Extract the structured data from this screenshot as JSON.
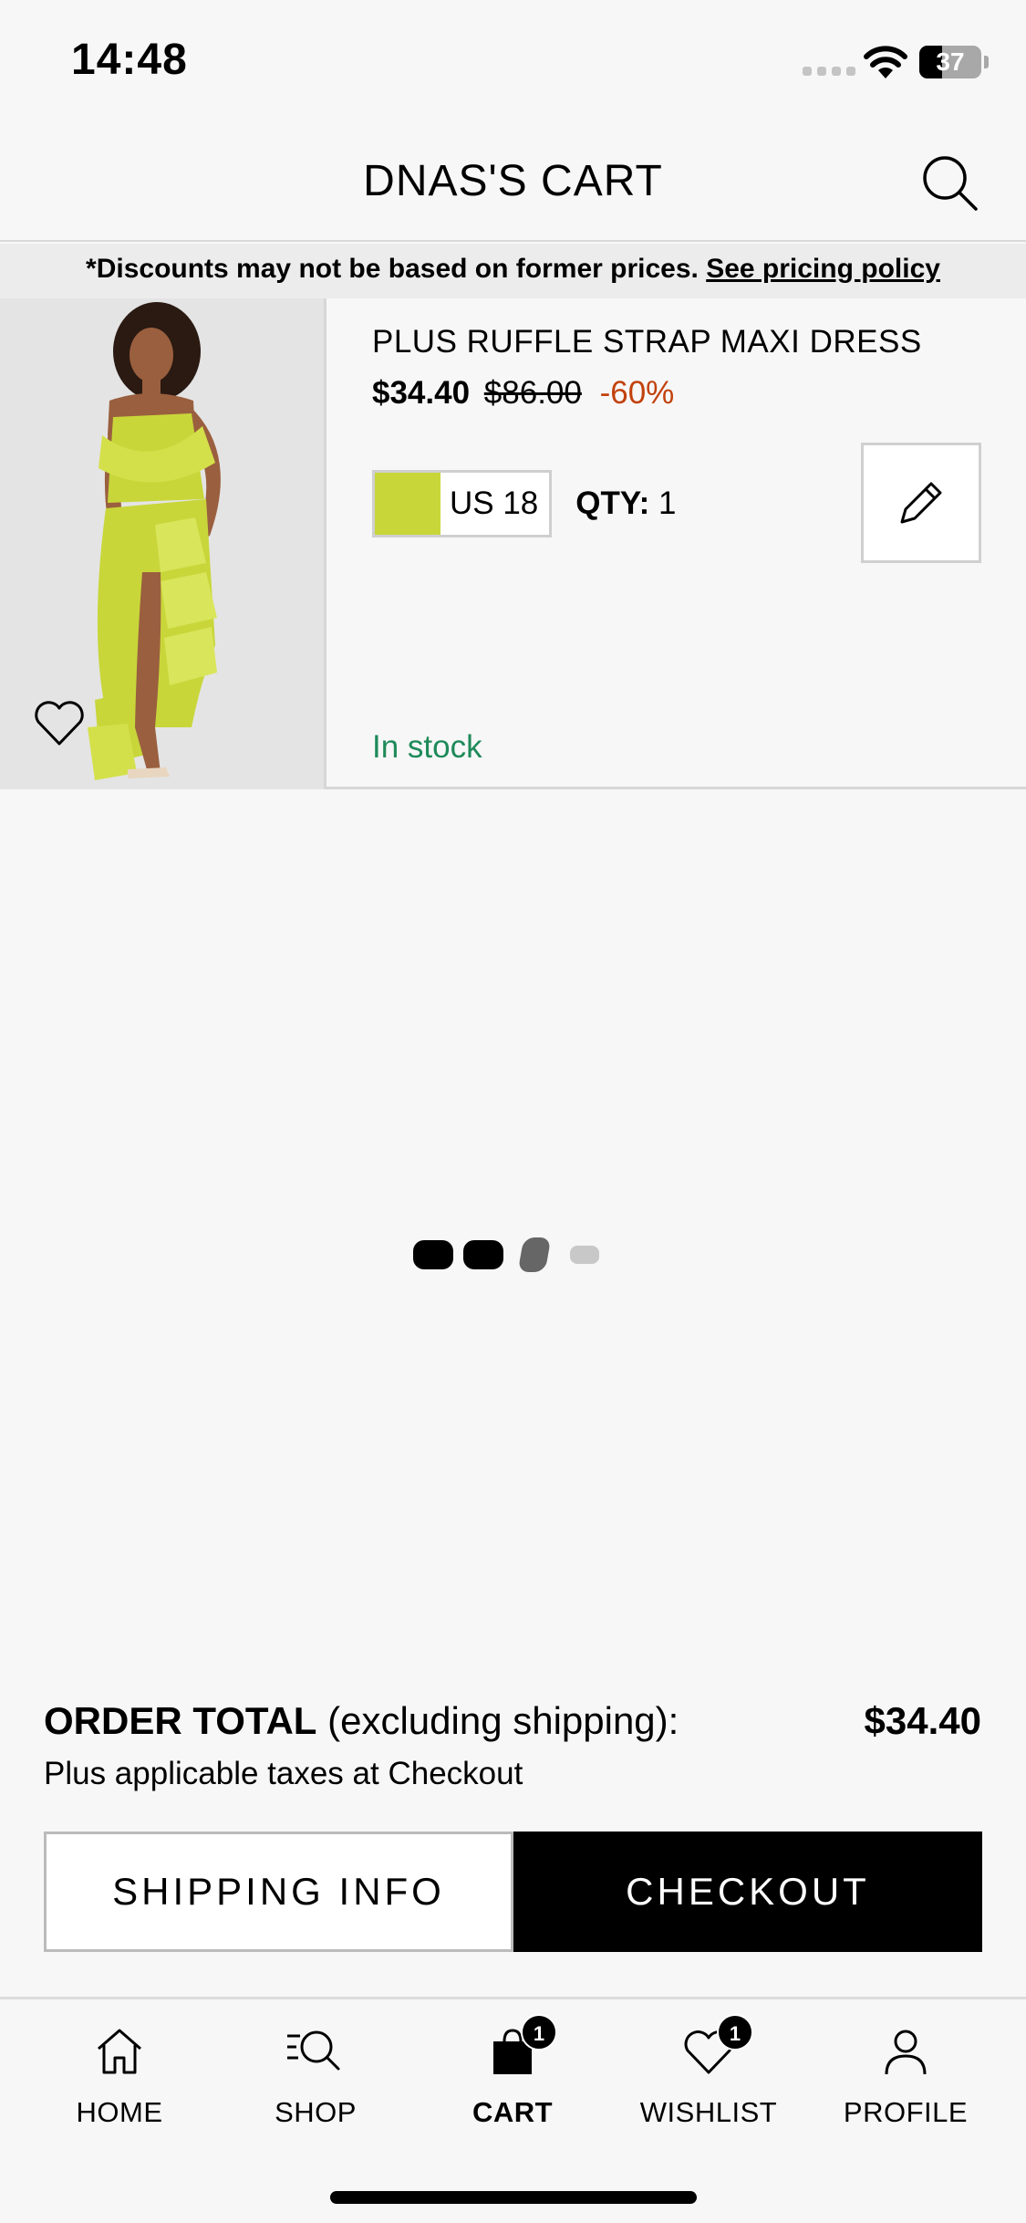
{
  "status_bar": {
    "time": "14:48",
    "battery": "37",
    "battery_level": 0.37
  },
  "header": {
    "title": "DNAS'S CART"
  },
  "banner": {
    "text": "*Discounts may not be based on former prices. ",
    "link": "See pricing policy"
  },
  "cart_item": {
    "name": "PLUS RUFFLE STRAP MAXI DRESS",
    "price": "$34.40",
    "original_price": "$86.00",
    "discount": "-60%",
    "size": "US 18",
    "qty_label": "QTY:",
    "qty_value": "1",
    "stock": "In stock",
    "colors": {
      "swatch": "#c8d63a",
      "stock": "#1f8a5a",
      "discount": "#c2410c"
    }
  },
  "order_total": {
    "label": "ORDER TOTAL",
    "label_suffix": " (excluding shipping):",
    "amount": "$34.40",
    "subtext": "Plus applicable taxes at Checkout"
  },
  "buttons": {
    "shipping": "SHIPPING INFO",
    "checkout": "CHECKOUT"
  },
  "tabbar": {
    "items": [
      {
        "label": "HOME",
        "icon": "home-icon"
      },
      {
        "label": "SHOP",
        "icon": "shop-search-icon"
      },
      {
        "label": "CART",
        "icon": "cart-bag-icon",
        "badge": "1",
        "active": true
      },
      {
        "label": "WISHLIST",
        "icon": "heart-icon",
        "badge": "1"
      },
      {
        "label": "PROFILE",
        "icon": "person-icon"
      }
    ]
  }
}
